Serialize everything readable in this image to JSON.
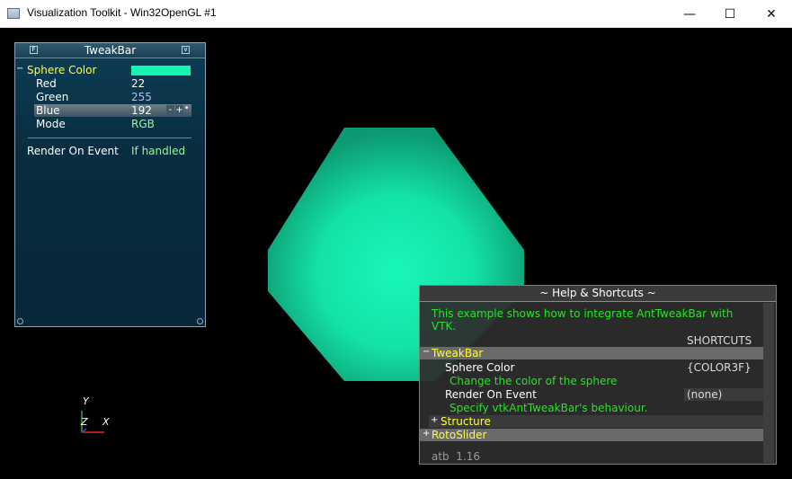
{
  "window": {
    "title": "Visualization Toolkit - Win32OpenGL #1",
    "minimize": "—",
    "maximize": "☐",
    "close": "✕"
  },
  "tweakbar": {
    "title": "TweakBar",
    "help_btn": "F",
    "iconify_btn": "v",
    "sphere_color": {
      "label": "Sphere Color",
      "toggle": "−",
      "swatch": "#16f5b0"
    },
    "red": {
      "label": "Red",
      "value": "22"
    },
    "green": {
      "label": "Green",
      "value": "255"
    },
    "blue": {
      "label": "Blue",
      "value": "192",
      "dec": "-",
      "inc": "+",
      "more": "•"
    },
    "mode": {
      "label": "Mode",
      "value": "RGB"
    },
    "render_on_event": {
      "label": "Render On Event",
      "value": "If handled"
    }
  },
  "help": {
    "title": "~ Help & Shortcuts ~",
    "intro_line1": "This example shows how to integrate AntTweakBar with",
    "intro_line2": "VTK.",
    "shortcuts_header": "SHORTCUTS",
    "tweakbar_group": {
      "toggle": "−",
      "label": "TweakBar"
    },
    "sphere_color": {
      "label": "Sphere Color",
      "shortcut": "{COLOR3F}",
      "desc": "Change the color of the sphere"
    },
    "render_on_event": {
      "label": "Render On Event",
      "shortcut": "(none)",
      "desc": "Specify vtkAntTweakBar's behaviour."
    },
    "structure": {
      "toggle": "+",
      "label": "Structure"
    },
    "rotoslider": {
      "toggle": "+",
      "label": "RotoSlider"
    },
    "footer": "atb  1.16"
  },
  "axes": {
    "y": "Y",
    "z": "Z",
    "x": "X"
  },
  "colors": {
    "sphere": "#16f5b0",
    "label_yellow": "#ffff3a",
    "value_green": "#8cff8c",
    "value_blue": "#b8b8ff",
    "help_green": "#22e822"
  }
}
